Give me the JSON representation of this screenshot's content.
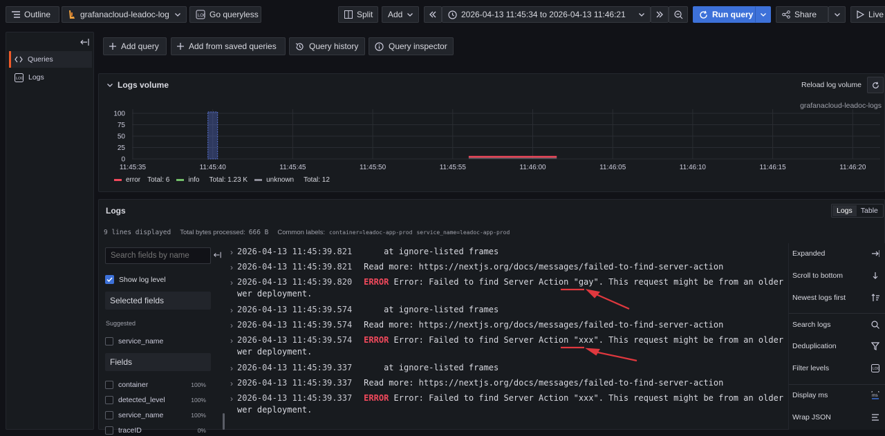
{
  "toolbar": {
    "outline": "Outline",
    "datasource": "grafanacloud-leadoc-log",
    "go_queryless": "Go queryless",
    "split": "Split",
    "add": "Add",
    "time_range": "2026-04-13 11:45:34 to 2026-04-13 11:46:21",
    "run_query": "Run query",
    "share": "Share",
    "live": "Live"
  },
  "sidebar": {
    "items": [
      {
        "label": "Queries",
        "icon": "code-icon"
      },
      {
        "label": "Logs",
        "icon": "logs-icon"
      }
    ]
  },
  "query_actions": {
    "add_query": "Add query",
    "add_saved": "Add from saved queries",
    "history": "Query history",
    "inspector": "Query inspector"
  },
  "volume": {
    "title": "Logs volume",
    "reload": "Reload log volume",
    "source": "grafanacloud-leadoc-logs",
    "legend": [
      {
        "name": "error",
        "color": "#f2495c",
        "total": "Total: 6"
      },
      {
        "name": "info",
        "color": "#73bf69",
        "total": "Total: 1.23 K"
      },
      {
        "name": "unknown",
        "color": "#8e8e99",
        "total": "Total: 12"
      }
    ]
  },
  "chart_data": {
    "type": "bar",
    "title": "Logs volume",
    "xlabel": "",
    "ylabel": "",
    "ylim": [
      0,
      100
    ],
    "yticks": [
      "100",
      "75",
      "50",
      "25",
      "0"
    ],
    "xticks": [
      "11:45:35",
      "11:45:40",
      "11:45:45",
      "11:45:50",
      "11:45:55",
      "11:46:00",
      "11:46:05",
      "11:46:10",
      "11:46:15",
      "11:46:20"
    ],
    "series": [
      {
        "name": "info",
        "color": "#5a74d6",
        "points": [
          {
            "x": "11:45:40",
            "value": 100
          }
        ]
      },
      {
        "name": "error",
        "color": "#f2495c",
        "points": [
          {
            "x": "11:45:56–11:46:03",
            "value": 1
          }
        ]
      }
    ],
    "grid": true,
    "legend": "bottom-left"
  },
  "logs": {
    "title": "Logs",
    "view_logs": "Logs",
    "view_table": "Table",
    "meta_lines": "9 lines displayed",
    "meta_bytes_label": "Total bytes processed:",
    "meta_bytes": "666 B",
    "meta_labels_label": "Common labels:",
    "label1": "container=leadoc-app-prod",
    "label2": "service_name=leadoc-app-prod",
    "rows": [
      {
        "ts": "2026-04-13 11:45:39.821",
        "level": "",
        "msg": "    at ignore-listed frames",
        "cont": ""
      },
      {
        "ts": "2026-04-13 11:45:39.821",
        "level": "",
        "msg": "Read more: https://nextjs.org/docs/messages/failed-to-find-server-action",
        "cont": ""
      },
      {
        "ts": "2026-04-13 11:45:39.820",
        "level": "ERROR",
        "msg": " Error: Failed to find Server Action \"gay\". This request might be from an older or ne",
        "cont": "wer deployment."
      },
      {
        "ts": "2026-04-13 11:45:39.574",
        "level": "",
        "msg": "    at ignore-listed frames",
        "cont": ""
      },
      {
        "ts": "2026-04-13 11:45:39.574",
        "level": "",
        "msg": "Read more: https://nextjs.org/docs/messages/failed-to-find-server-action",
        "cont": ""
      },
      {
        "ts": "2026-04-13 11:45:39.574",
        "level": "ERROR",
        "msg": " Error: Failed to find Server Action \"xxx\". This request might be from an older or ne",
        "cont": "wer deployment."
      },
      {
        "ts": "2026-04-13 11:45:39.337",
        "level": "",
        "msg": "    at ignore-listed frames",
        "cont": ""
      },
      {
        "ts": "2026-04-13 11:45:39.337",
        "level": "",
        "msg": "Read more: https://nextjs.org/docs/messages/failed-to-find-server-action",
        "cont": ""
      },
      {
        "ts": "2026-04-13 11:45:39.337",
        "level": "ERROR",
        "msg": " Error: Failed to find Server Action \"xxx\". This request might be from an older or ne",
        "cont": "wer deployment."
      }
    ]
  },
  "fields": {
    "search_placeholder": "Search fields by name",
    "show_log_level": "Show log level",
    "selected": "Selected fields",
    "suggested": "Suggested",
    "suggested_items": [
      "service_name"
    ],
    "fields_title": "Fields",
    "items": [
      {
        "name": "container",
        "pct": "100%"
      },
      {
        "name": "detected_level",
        "pct": "100%"
      },
      {
        "name": "service_name",
        "pct": "100%"
      },
      {
        "name": "traceID",
        "pct": "0%"
      }
    ]
  },
  "options": {
    "items": [
      {
        "label": "Expanded",
        "icon": "expand-icon"
      },
      {
        "label": "Scroll to bottom",
        "icon": "arrow-down-icon"
      },
      {
        "label": "Newest logs first",
        "icon": "sort-icon"
      },
      {
        "label": "Search logs",
        "icon": "search-icon"
      },
      {
        "label": "Deduplication",
        "icon": "filter-icon"
      },
      {
        "label": "Filter levels",
        "icon": "levels-icon"
      },
      {
        "label": "Display ms",
        "icon": "ms-icon"
      },
      {
        "label": "Wrap JSON",
        "icon": "wrap-icon"
      }
    ]
  },
  "colors": {
    "accent": "#3d71d9",
    "error": "#f2495c",
    "info": "#73bf69",
    "unknown": "#8e8e99",
    "annotation": "#e0383e"
  }
}
